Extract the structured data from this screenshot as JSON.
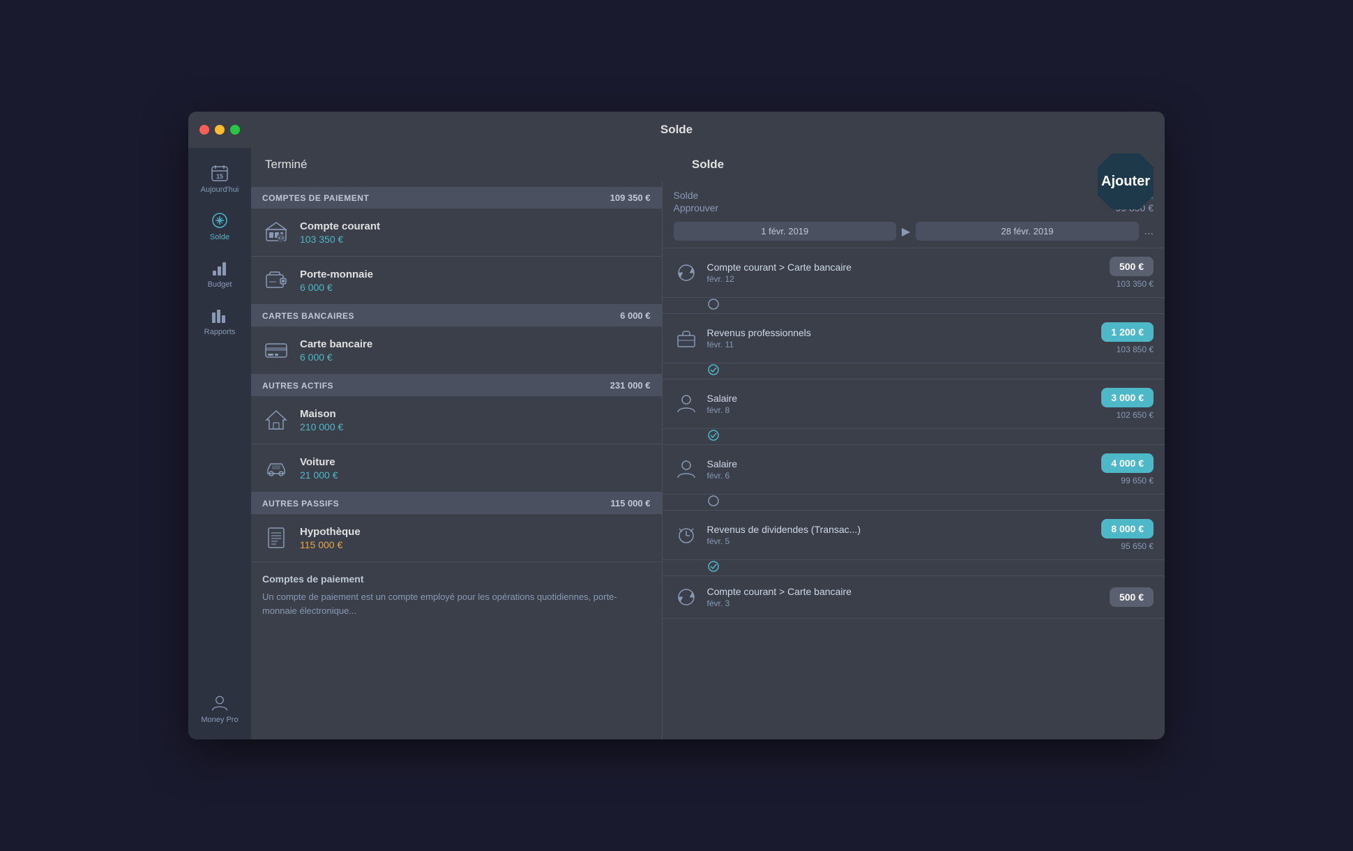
{
  "window": {
    "title": "Solde"
  },
  "titlebar": {
    "title": "Solde"
  },
  "header": {
    "left_button": "Terminé",
    "center_title": "Solde",
    "right_button": "Ajouter"
  },
  "sidebar": {
    "items": [
      {
        "id": "today",
        "label": "Aujourd'hui",
        "icon": "calendar"
      },
      {
        "id": "solde",
        "label": "Solde",
        "icon": "balance"
      },
      {
        "id": "budget",
        "label": "Budget",
        "icon": "budget"
      },
      {
        "id": "rapports",
        "label": "Rapports",
        "icon": "chart"
      }
    ],
    "bottom": {
      "label": "Money Pro",
      "icon": "user"
    }
  },
  "left_panel": {
    "sections": [
      {
        "id": "comptes-paiement",
        "name": "COMPTES DE PAIEMENT",
        "amount": "109 350 €",
        "accounts": [
          {
            "id": "compte-courant",
            "name": "Compte courant",
            "amount": "103 350 €",
            "color": "teal",
            "icon": "bank"
          },
          {
            "id": "porte-monnaie",
            "name": "Porte-monnaie",
            "amount": "6 000 €",
            "color": "teal",
            "icon": "wallet"
          }
        ]
      },
      {
        "id": "cartes-bancaires",
        "name": "CARTES BANCAIRES",
        "amount": "6 000 €",
        "accounts": [
          {
            "id": "carte-bancaire",
            "name": "Carte bancaire",
            "amount": "6 000 €",
            "color": "teal",
            "icon": "card"
          }
        ]
      },
      {
        "id": "autres-actifs",
        "name": "AUTRES ACTIFS",
        "amount": "231 000 €",
        "accounts": [
          {
            "id": "maison",
            "name": "Maison",
            "amount": "210 000 €",
            "color": "teal",
            "icon": "house"
          },
          {
            "id": "voiture",
            "name": "Voiture",
            "amount": "21 000 €",
            "color": "teal",
            "icon": "car"
          }
        ]
      },
      {
        "id": "autres-passifs",
        "name": "AUTRES PASSIFS",
        "amount": "115 000 €",
        "accounts": [
          {
            "id": "hypotheque",
            "name": "Hypothèque",
            "amount": "115 000 €",
            "color": "orange",
            "icon": "document"
          }
        ]
      }
    ],
    "description": {
      "title": "Comptes de paiement",
      "text": "Un compte de paiement est un compte employé pour les opérations quotidiennes, porte-monnaie électronique..."
    }
  },
  "right_panel": {
    "header": {
      "solde_label": "Solde",
      "solde_value": "103 ...",
      "approuver_label": "Approuver",
      "approuver_value": "99 850 €"
    },
    "date_range": {
      "start": "1 févr. 2019",
      "end": "28 févr. 2019",
      "dots": "..."
    },
    "transactions": [
      {
        "id": "t1",
        "icon": "refresh",
        "name": "Compte courant > Carte bancaire",
        "date": "févr. 12",
        "amount": "500 €",
        "amount_color": "gray",
        "balance": "103 350 €",
        "status": "circle"
      },
      {
        "id": "t2",
        "icon": "briefcase",
        "name": "Revenus professionnels",
        "date": "févr. 11",
        "amount": "1 200 €",
        "amount_color": "teal",
        "balance": "103 850 €",
        "status": "check"
      },
      {
        "id": "t3",
        "icon": "person",
        "name": "Salaire",
        "date": "févr. 8",
        "amount": "3 000 €",
        "amount_color": "teal",
        "balance": "102 650 €",
        "status": "check"
      },
      {
        "id": "t4",
        "icon": "person",
        "name": "Salaire",
        "date": "févr. 6",
        "amount": "4 000 €",
        "amount_color": "teal",
        "balance": "99 650 €",
        "status": "circle"
      },
      {
        "id": "t5",
        "icon": "alarm",
        "name": "Revenus de dividendes (Transac...)",
        "date": "févr. 5",
        "amount": "8 000 €",
        "amount_color": "teal",
        "balance": "95 650 €",
        "status": "check"
      },
      {
        "id": "t6",
        "icon": "refresh",
        "name": "Compte courant > Carte bancaire",
        "date": "févr. 3",
        "amount": "500 €",
        "amount_color": "gray",
        "balance": "",
        "status": "circle"
      }
    ]
  }
}
